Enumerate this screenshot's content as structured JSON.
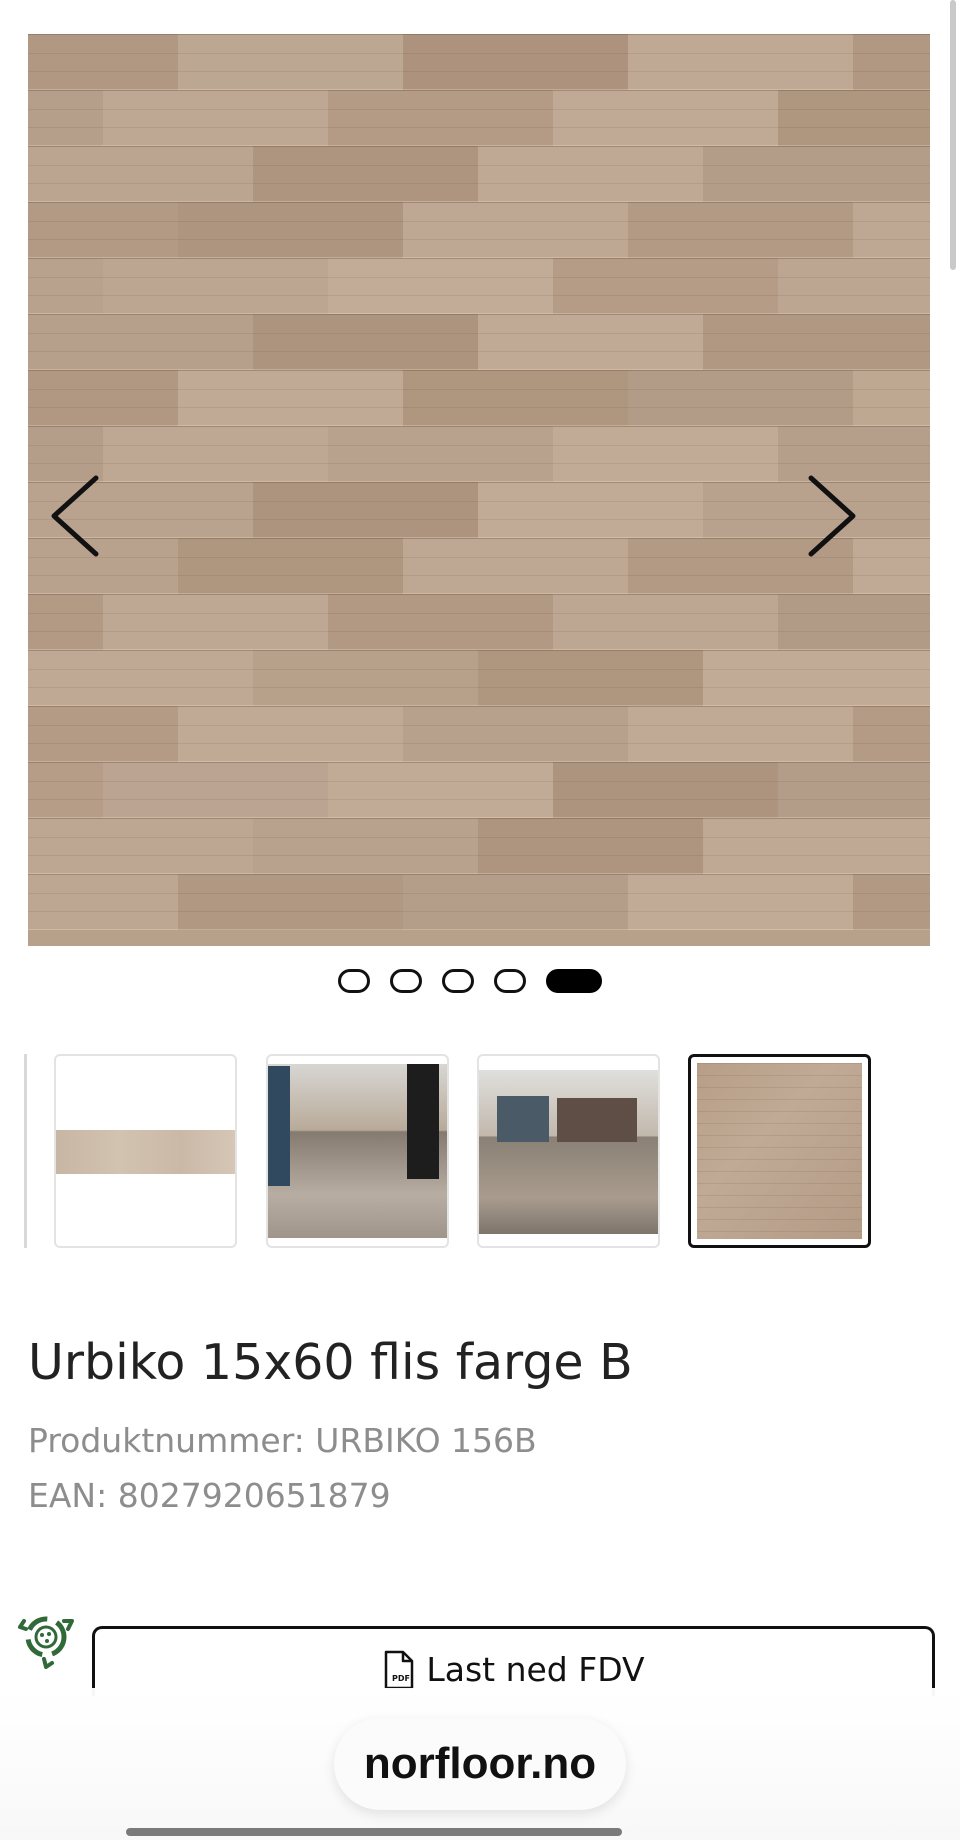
{
  "product": {
    "title": "Urbiko 15x60 flis farge B",
    "sku_line": "Produktnummer: URBIKO 156B",
    "ean_line": "EAN: 8027920651879"
  },
  "gallery": {
    "active_index": 4,
    "dot_count": 5,
    "thumbnails": [
      {
        "subject": "single plank tile"
      },
      {
        "subject": "store interior with clothing racks"
      },
      {
        "subject": "store interior with display table"
      },
      {
        "subject": "plank floor pattern"
      }
    ]
  },
  "actions": {
    "download_fdv_label": "Last ned FDV"
  },
  "browser": {
    "url": "norfloor.no"
  },
  "colors": {
    "accent": "#111111",
    "secondary_text": "#8d8d8d",
    "badge_green": "#2f6a38"
  },
  "icons": {
    "prev": "chevron-left-icon",
    "next": "chevron-right-icon",
    "pdf": "pdf-icon",
    "eco_badge": "recycle-badge-icon"
  }
}
